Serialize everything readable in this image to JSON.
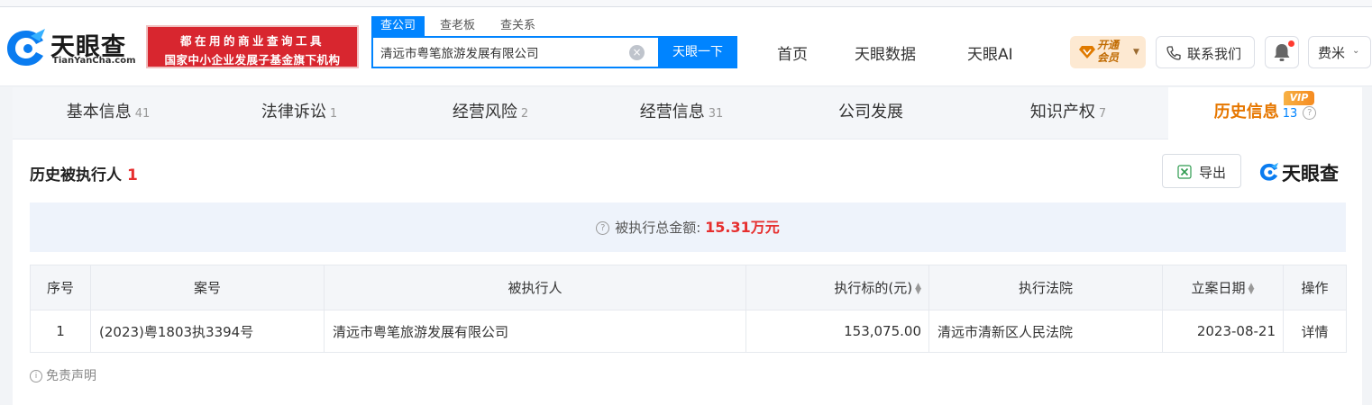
{
  "header": {
    "logo_cn": "天眼查",
    "logo_en": "TianYanCha.com",
    "promo_line1": "都在用的商业查询工具",
    "promo_line2": "国家中小企业发展子基金旗下机构",
    "search_tabs": [
      "查公司",
      "查老板",
      "查关系"
    ],
    "search_value": "清远市粤笔旅游发展有限公司",
    "search_button": "天眼一下",
    "nav": [
      "首页",
      "天眼数据",
      "天眼AI"
    ],
    "vip_open": [
      "开通",
      "会员"
    ],
    "contact": "联系我们",
    "user": "费米"
  },
  "tabs": [
    {
      "label": "基本信息",
      "count": "41"
    },
    {
      "label": "法律诉讼",
      "count": "1"
    },
    {
      "label": "经营风险",
      "count": "2"
    },
    {
      "label": "经营信息",
      "count": "31"
    },
    {
      "label": "公司发展",
      "count": ""
    },
    {
      "label": "知识产权",
      "count": "7"
    },
    {
      "label": "历史信息",
      "count": "13",
      "badge": "VIP"
    }
  ],
  "section": {
    "title": "历史被执行人",
    "count": "1",
    "export": "导出",
    "brand": "天眼查"
  },
  "summary": {
    "label": "被执行总金额:",
    "amount": "15.31万元"
  },
  "table": {
    "headers": [
      "序号",
      "案号",
      "被执行人",
      "执行标的(元)",
      "执行法院",
      "立案日期",
      "操作"
    ],
    "rows": [
      {
        "index": "1",
        "case_no": "(2023)粤1803执3394号",
        "party": "清远市粤笔旅游发展有限公司",
        "amount": "153,075.00",
        "court": "清远市清新区人民法院",
        "date": "2023-08-21",
        "action": "详情"
      }
    ]
  },
  "disclaimer": "免责声明",
  "colors": {
    "primary": "#0084ff",
    "accent_orange": "#e67700",
    "alert_red": "#e62e2e",
    "promo_red": "#d8262f"
  }
}
